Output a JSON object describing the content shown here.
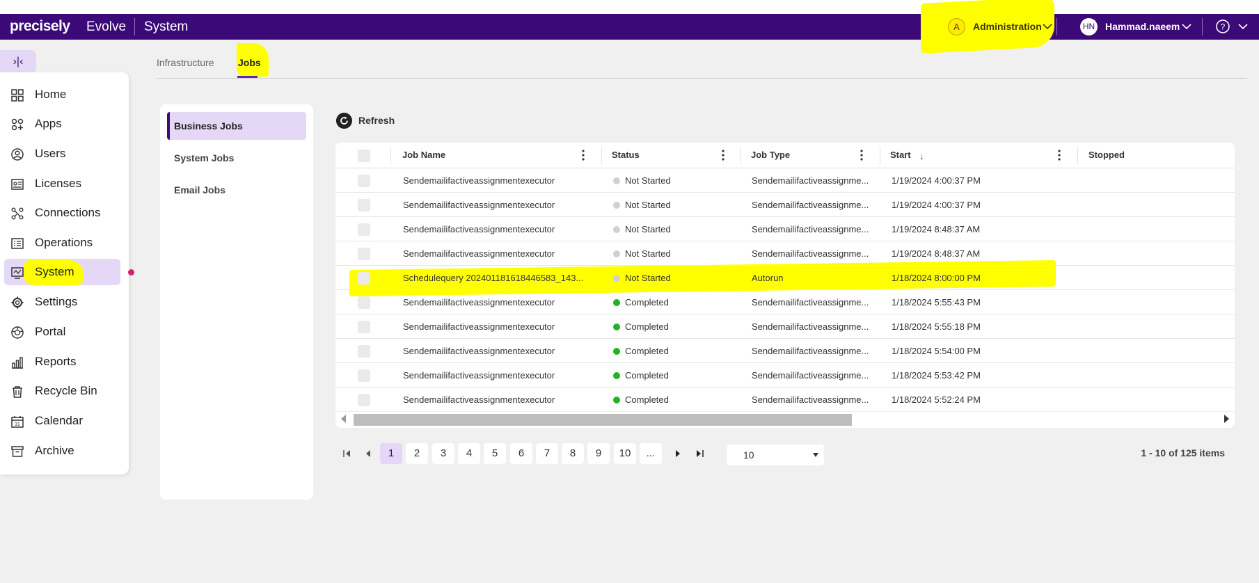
{
  "header": {
    "logo": "precisely",
    "app_name": "Evolve",
    "section": "System",
    "admin_initial": "A",
    "admin_label": "Administration",
    "user_initials": "HN",
    "user_name": "Hammad.naeem",
    "brand_color": "#3c0a78"
  },
  "sidebar": {
    "collapse_label": "›|‹",
    "items": [
      {
        "label": "Home",
        "icon": "grid-icon"
      },
      {
        "label": "Apps",
        "icon": "apps-icon"
      },
      {
        "label": "Users",
        "icon": "user-icon"
      },
      {
        "label": "Licenses",
        "icon": "license-icon"
      },
      {
        "label": "Connections",
        "icon": "connections-icon"
      },
      {
        "label": "Operations",
        "icon": "operations-icon"
      },
      {
        "label": "System",
        "icon": "system-icon",
        "active": true
      },
      {
        "label": "Settings",
        "icon": "gear-icon"
      },
      {
        "label": "Portal",
        "icon": "portal-icon"
      },
      {
        "label": "Reports",
        "icon": "reports-icon"
      },
      {
        "label": "Recycle Bin",
        "icon": "trash-icon"
      },
      {
        "label": "Calendar",
        "icon": "calendar-icon"
      },
      {
        "label": "Archive",
        "icon": "archive-icon"
      }
    ]
  },
  "tabs": [
    {
      "label": "Infrastructure"
    },
    {
      "label": "Jobs",
      "active": true
    }
  ],
  "jobs_menu": [
    {
      "label": "Business Jobs",
      "active": true
    },
    {
      "label": "System Jobs"
    },
    {
      "label": "Email Jobs"
    }
  ],
  "toolbar": {
    "refresh_label": "Refresh"
  },
  "grid": {
    "columns": [
      "Job Name",
      "Status",
      "Job Type",
      "Start",
      "Stopped"
    ],
    "rows": [
      {
        "name": "Sendemailifactiveassignmentexecutor",
        "status": "Not Started",
        "type": "Sendemailifactiveassignme...",
        "start": "1/19/2024 4:00:37 PM"
      },
      {
        "name": "Sendemailifactiveassignmentexecutor",
        "status": "Not Started",
        "type": "Sendemailifactiveassignme...",
        "start": "1/19/2024 4:00:37 PM"
      },
      {
        "name": "Sendemailifactiveassignmentexecutor",
        "status": "Not Started",
        "type": "Sendemailifactiveassignme...",
        "start": "1/19/2024 8:48:37 AM"
      },
      {
        "name": "Sendemailifactiveassignmentexecutor",
        "status": "Not Started",
        "type": "Sendemailifactiveassignme...",
        "start": "1/19/2024 8:48:37 AM"
      },
      {
        "name": "Schedulequery 202401181618446583_143...",
        "status": "Not Started",
        "type": "Autorun",
        "start": "1/18/2024 8:00:00 PM"
      },
      {
        "name": "Sendemailifactiveassignmentexecutor",
        "status": "Completed",
        "type": "Sendemailifactiveassignme...",
        "start": "1/18/2024 5:55:43 PM"
      },
      {
        "name": "Sendemailifactiveassignmentexecutor",
        "status": "Completed",
        "type": "Sendemailifactiveassignme...",
        "start": "1/18/2024 5:55:18 PM"
      },
      {
        "name": "Sendemailifactiveassignmentexecutor",
        "status": "Completed",
        "type": "Sendemailifactiveassignme...",
        "start": "1/18/2024 5:54:00 PM"
      },
      {
        "name": "Sendemailifactiveassignmentexecutor",
        "status": "Completed",
        "type": "Sendemailifactiveassignme...",
        "start": "1/18/2024 5:53:42 PM"
      },
      {
        "name": "Sendemailifactiveassignmentexecutor",
        "status": "Completed",
        "type": "Sendemailifactiveassignme...",
        "start": "1/18/2024 5:52:24 PM"
      }
    ],
    "status_colors": {
      "Not Started": "#d0d0d0",
      "Completed": "#22b322"
    },
    "sort_icon": "sort-down-arrow-icon"
  },
  "pager": {
    "pages": [
      "1",
      "2",
      "3",
      "4",
      "5",
      "6",
      "7",
      "8",
      "9",
      "10",
      "..."
    ],
    "current_page": "1",
    "page_size": "10",
    "items_info": "1 - 10 of 125 items"
  }
}
